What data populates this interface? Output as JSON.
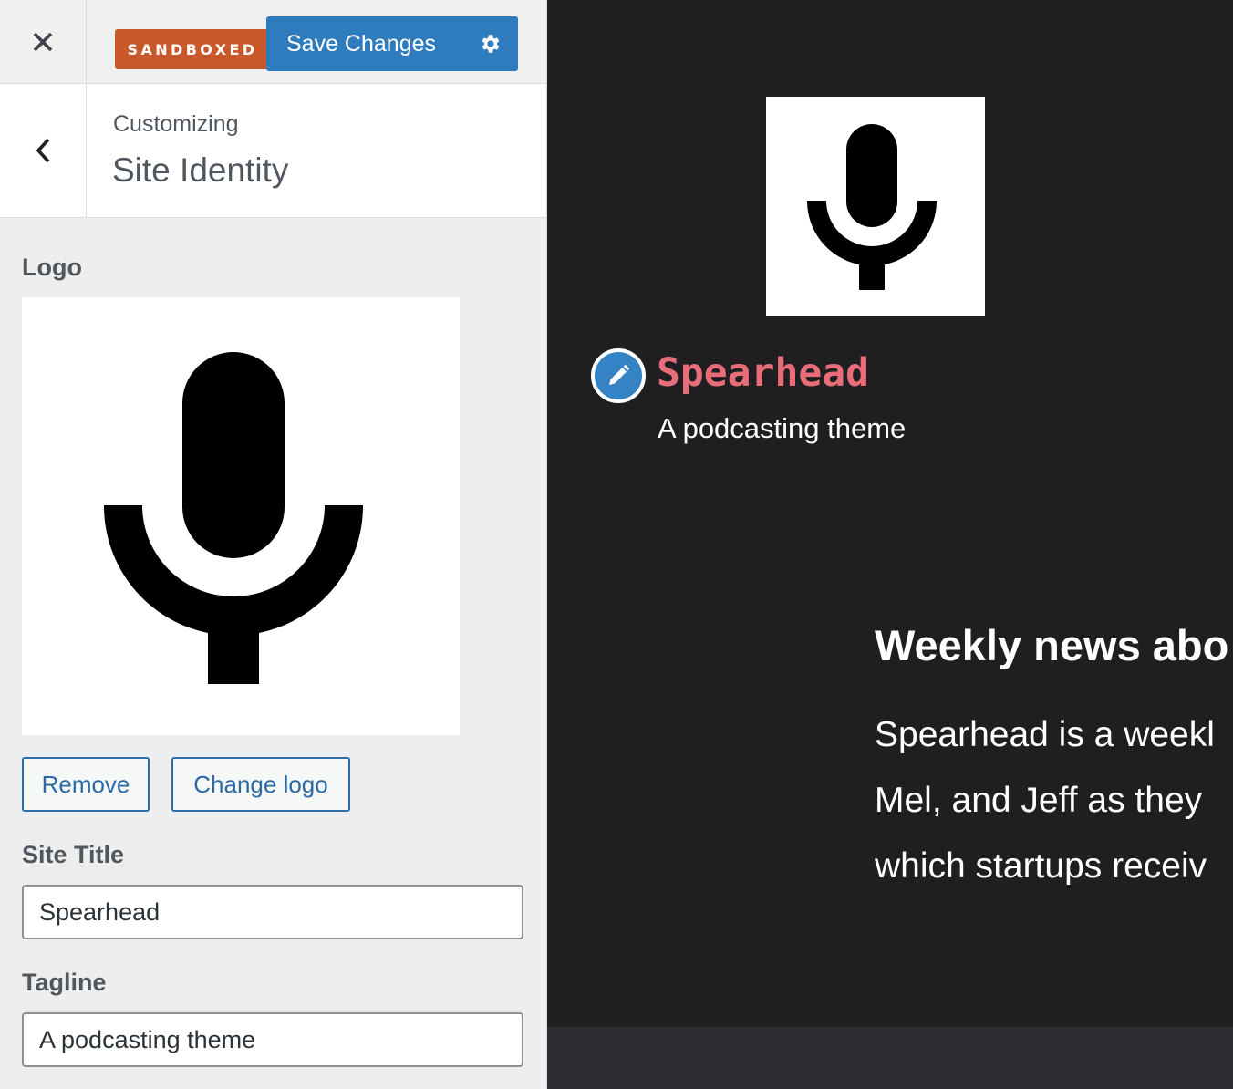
{
  "header": {
    "close_icon": "close-icon",
    "badge": "SANDBOXED",
    "save_label": "Save Changes",
    "settings_icon": "gear-icon"
  },
  "section": {
    "back_icon": "chevron-left-icon",
    "customizing": "Customizing",
    "title": "Site Identity"
  },
  "logo": {
    "label": "Logo",
    "image_icon": "microphone-icon",
    "remove_label": "Remove",
    "change_label": "Change logo"
  },
  "site_title": {
    "label": "Site Title",
    "value": "Spearhead"
  },
  "tagline": {
    "label": "Tagline",
    "value": "A podcasting theme"
  },
  "preview": {
    "logo_icon": "microphone-icon",
    "edit_icon": "pencil-icon",
    "site_title": "Spearhead",
    "tagline": "A podcasting theme",
    "heading": "Weekly news abo",
    "lines": [
      "Spearhead is a weekl",
      "Mel, and Jeff as they",
      "which startups receiv"
    ]
  },
  "colors": {
    "accent": "#2e7bbd",
    "badge": "#c9582b",
    "preview_bg": "#1f1f22",
    "preview_title": "#e96d79"
  }
}
